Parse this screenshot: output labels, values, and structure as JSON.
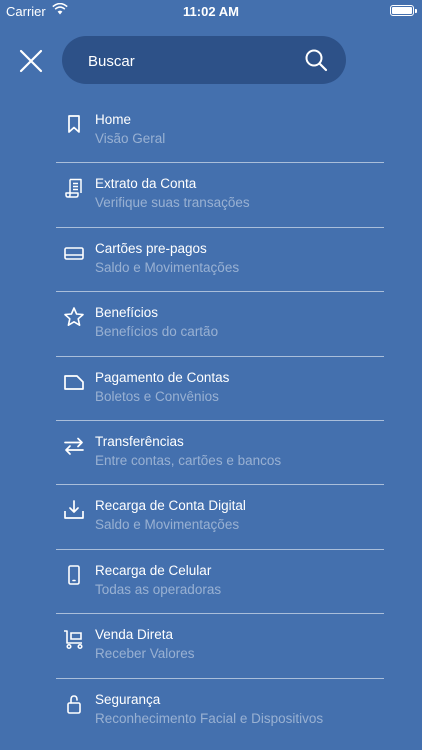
{
  "status_bar": {
    "carrier": "Carrier",
    "time": "11:02 AM"
  },
  "search": {
    "placeholder": "Buscar"
  },
  "menu": [
    {
      "icon": "bookmark-icon",
      "title": "Home",
      "subtitle": "Visão Geral"
    },
    {
      "icon": "receipt-icon",
      "title": "Extrato da Conta",
      "subtitle": "Verifique suas transações"
    },
    {
      "icon": "card-icon",
      "title": "Cartões pre-pagos",
      "subtitle": "Saldo e Movimentações"
    },
    {
      "icon": "star-icon",
      "title": "Benefícios",
      "subtitle": "Benefícios do cartão"
    },
    {
      "icon": "document-icon",
      "title": "Pagamento de Contas",
      "subtitle": "Boletos e Convênios"
    },
    {
      "icon": "transfer-icon",
      "title": "Transferências",
      "subtitle": "Entre contas, cartões e bancos"
    },
    {
      "icon": "download-icon",
      "title": "Recarga de Conta Digital",
      "subtitle": "Saldo e Movimentações"
    },
    {
      "icon": "phone-icon",
      "title": "Recarga de Celular",
      "subtitle": "Todas as operadoras"
    },
    {
      "icon": "cart-icon",
      "title": "Venda Direta",
      "subtitle": "Receber Valores"
    },
    {
      "icon": "lock-icon",
      "title": "Segurança",
      "subtitle": "Reconhecimento Facial e Dispositivos"
    }
  ]
}
